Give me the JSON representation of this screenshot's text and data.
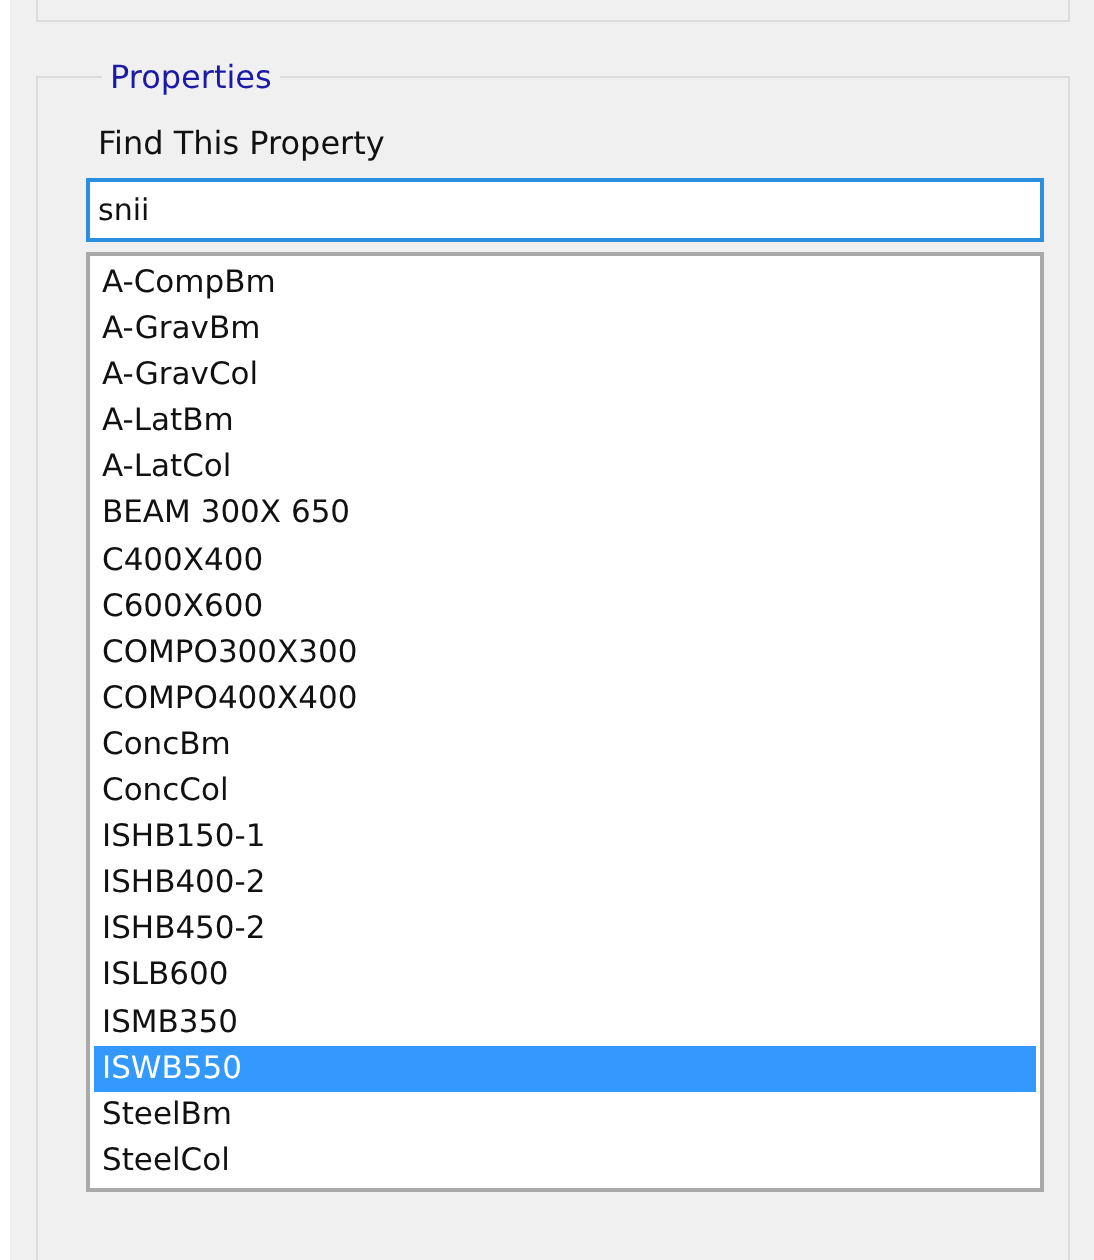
{
  "group": {
    "title": "Properties"
  },
  "search": {
    "label": "Find This Property",
    "value": "snii"
  },
  "list": [
    {
      "label": "A-CompBm",
      "selected": false
    },
    {
      "label": "A-GravBm",
      "selected": false
    },
    {
      "label": "A-GravCol",
      "selected": false
    },
    {
      "label": "A-LatBm",
      "selected": false
    },
    {
      "label": "A-LatCol",
      "selected": false
    },
    {
      "label": "BEAM 300X 650",
      "selected": false
    },
    {
      "label": "C400X400",
      "selected": false
    },
    {
      "label": "C600X600",
      "selected": false
    },
    {
      "label": "COMPO300X300",
      "selected": false
    },
    {
      "label": "COMPO400X400",
      "selected": false
    },
    {
      "label": "ConcBm",
      "selected": false
    },
    {
      "label": "ConcCol",
      "selected": false
    },
    {
      "label": "ISHB150-1",
      "selected": false
    },
    {
      "label": "ISHB400-2",
      "selected": false
    },
    {
      "label": "ISHB450-2",
      "selected": false
    },
    {
      "label": "ISLB600",
      "selected": false
    },
    {
      "label": "ISMB350",
      "selected": false
    },
    {
      "label": "ISWB550",
      "selected": true
    },
    {
      "label": "SteelBm",
      "selected": false
    },
    {
      "label": "SteelCol",
      "selected": false
    }
  ]
}
